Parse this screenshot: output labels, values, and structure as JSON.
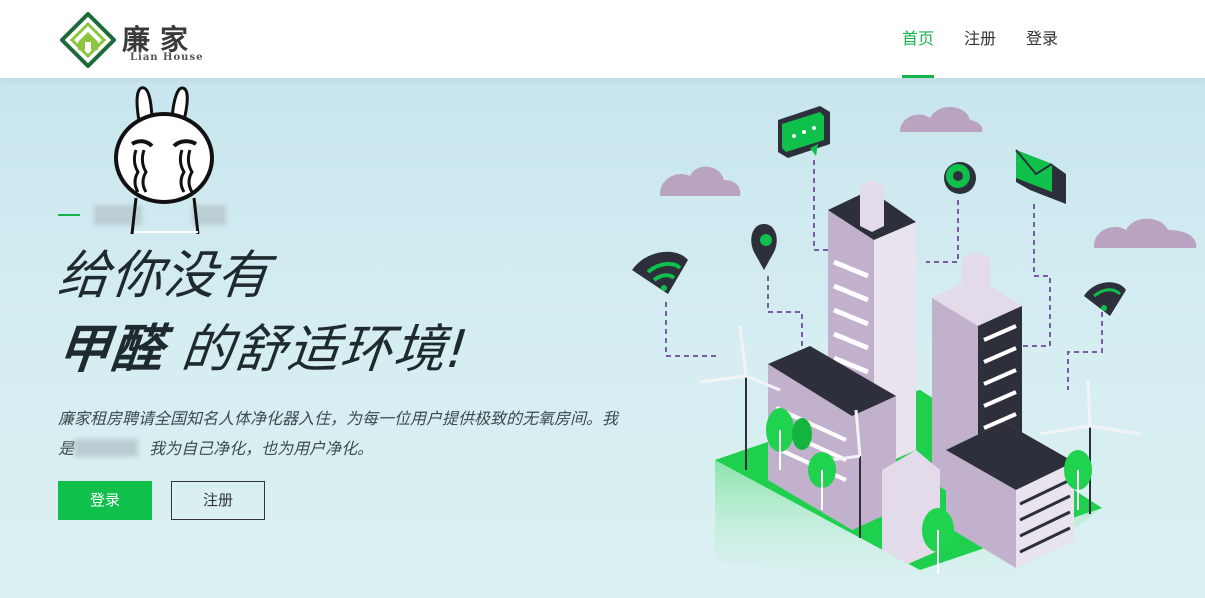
{
  "brand": {
    "name_cn": "廉家",
    "name_en": "Lian House",
    "colors": {
      "primary": "#16b24a",
      "button": "#0fc04a",
      "dark": "#333333"
    }
  },
  "nav": {
    "items": [
      {
        "label": "首页",
        "active": true
      },
      {
        "label": "注册",
        "active": false
      },
      {
        "label": "登录",
        "active": false
      }
    ]
  },
  "hero": {
    "headline_line1": "给你没有",
    "headline_bold": "甲醛",
    "headline_rest": " 的舒适环境!",
    "description_part1": "廉家租房聘请全国知名人体净化器入住，为每一位用户提供极致的无氧房间。我是",
    "description_part2": " 我为自己净化，也为用户净化。",
    "login_button": "登录",
    "register_button": "注册"
  },
  "icons": [
    "chat-bubble-icon",
    "map-pin-icon",
    "wifi-icon",
    "gear-icon",
    "envelope-icon",
    "cloud-icon"
  ]
}
